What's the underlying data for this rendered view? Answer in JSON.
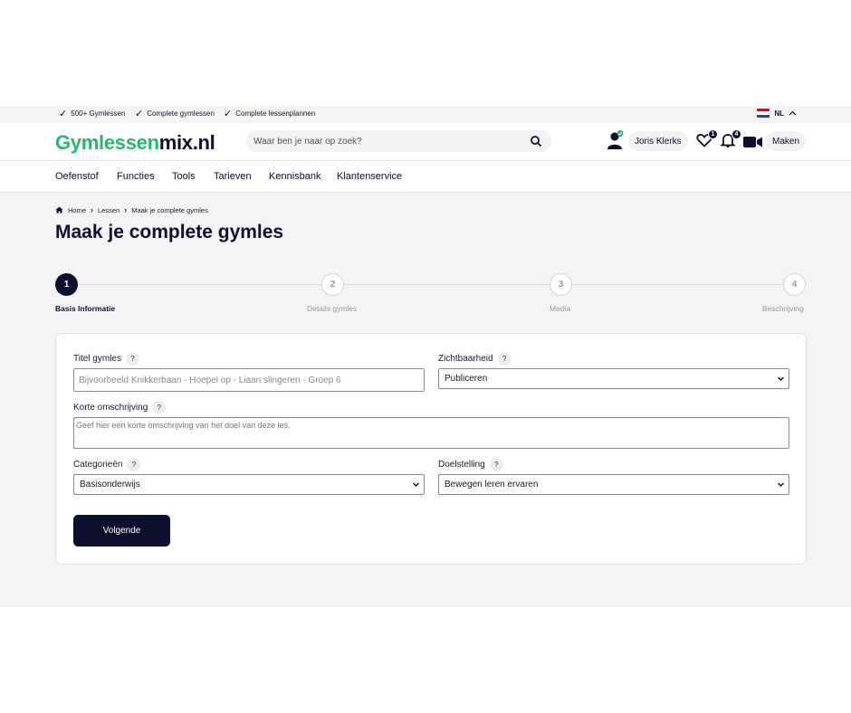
{
  "topbar": {
    "usps": [
      "500+ Gymlessen",
      "Complete gymlessen",
      "Complete lessenplannen"
    ],
    "language": "NL"
  },
  "header": {
    "logo": {
      "part1": "Gymlessen",
      "part2": "mix",
      "part3": ".nl"
    },
    "search_placeholder": "Waar ben je naar op zoek?",
    "user_name": "Joris Klerks",
    "favorites_count": "1",
    "notifications_count": "4",
    "create_label": "Maken"
  },
  "nav": {
    "items": [
      "Oefenstof",
      "Functies",
      "Tools",
      "Tarieven",
      "Kennisbank",
      "Klantenservice"
    ]
  },
  "breadcrumb": {
    "home": "Home",
    "lessons": "Lessen",
    "current": "Maak je complete gymles"
  },
  "page_title": "Maak je complete gymles",
  "stepper": {
    "steps": [
      {
        "number": "1",
        "label": "Basis Informatie"
      },
      {
        "number": "2",
        "label": "Details gymles"
      },
      {
        "number": "3",
        "label": "Media"
      },
      {
        "number": "4",
        "label": "Beschrijving"
      }
    ],
    "active_step": 1
  },
  "form": {
    "title_label": "Titel gymles",
    "title_placeholder": "Bijvoorbeeld Knikkerbaan - Hoepel op - Liaan slingeren - Groep 6",
    "visibility_label": "Zichtbaarheid",
    "visibility_value": "Publiceren",
    "description_label": "Korte omschrijving",
    "description_placeholder": "Geef hier een korte omschrijving van het doel van deze les.",
    "categories_label": "Categorieën",
    "categories_value": "Basisonderwijs",
    "goal_label": "Doelstelling",
    "goal_value": "Bewegen leren ervaren",
    "help_symbol": "?",
    "next_button": "Volgende"
  },
  "colors": {
    "brand_dark": "#0d0f2e",
    "brand_green": "#2bb673",
    "background": "#f3f3f3"
  }
}
